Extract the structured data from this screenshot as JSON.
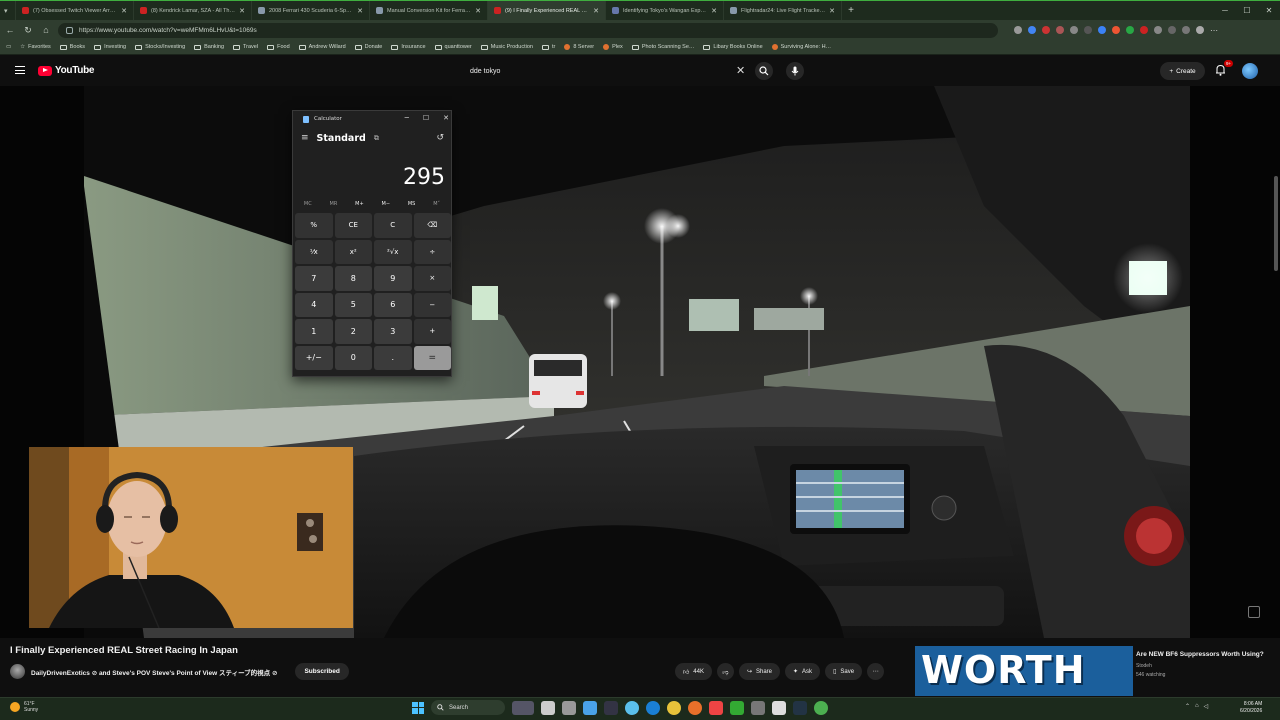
{
  "browser": {
    "tabs": [
      {
        "title": "(7) Obsessed Twitch Viewer Arre…",
        "color": "#cc2222"
      },
      {
        "title": "(8) Kendrick Lamar, SZA - All The…",
        "color": "#cc2222"
      },
      {
        "title": "2008 Ferrari 430 Scuderia 6-Spee…",
        "color": "#8899aa"
      },
      {
        "title": "Manual Conversion Kit for Ferrari…",
        "color": "#8899aa"
      },
      {
        "title": "(9) I Finally Experienced REAL Stre…",
        "color": "#cc2222"
      },
      {
        "title": "Identifying Tokyo's Wangan Expr…",
        "color": "#6677aa"
      },
      {
        "title": "Flightradar24: Live Flight Tracker …",
        "color": "#8899aa"
      }
    ],
    "url": "https://www.youtube.com/watch?v=weMFMm6LHvU&t=1069s",
    "bookmarks": [
      {
        "label": "Favorites",
        "type": "star"
      },
      {
        "label": "Books",
        "type": "folder"
      },
      {
        "label": "Investing",
        "type": "folder"
      },
      {
        "label": "Stocks/Investing",
        "type": "folder"
      },
      {
        "label": "Banking",
        "type": "folder"
      },
      {
        "label": "Travel",
        "type": "folder"
      },
      {
        "label": "Food",
        "type": "folder"
      },
      {
        "label": "Andrew Willard",
        "type": "folder"
      },
      {
        "label": "Donate",
        "type": "folder"
      },
      {
        "label": "Insurance",
        "type": "folder"
      },
      {
        "label": "quanttower",
        "type": "folder"
      },
      {
        "label": "Music Production",
        "type": "folder"
      },
      {
        "label": "tr",
        "type": "folder"
      },
      {
        "label": "8 Server",
        "type": "site"
      },
      {
        "label": "Plex",
        "type": "site"
      },
      {
        "label": "Photo Scanning Se…",
        "type": "folder"
      },
      {
        "label": "Libary Books Online",
        "type": "folder"
      },
      {
        "label": "Surviving Alone: H…",
        "type": "site"
      }
    ]
  },
  "youtube": {
    "logo": "YouTube",
    "search_value": "dde tokyo",
    "create_label": "Create",
    "notif_badge": "9+",
    "video_title": "I Finally Experienced REAL Street Racing In Japan",
    "channel": "DailyDrivenExotics ⊘ and Steve's POV Steve's Point of View スティーブ的視点 ⊘",
    "subscribe_label": "Subscribed",
    "actions": {
      "likes": "44K",
      "share": "Share",
      "ask": "Ask",
      "save": "Save"
    },
    "recommended": {
      "thumb_text": "WORTH IT?",
      "title": "Are NEW BF6 Suppressors Worth Using?",
      "channel": "Stodeh",
      "watching": "546 watching"
    }
  },
  "calculator": {
    "app_title": "Calculator",
    "mode": "Standard",
    "display": "295",
    "memory": [
      "MC",
      "MR",
      "M+",
      "M−",
      "MS",
      "M˅"
    ],
    "keys": [
      "%",
      "CE",
      "C",
      "⌫",
      "⅟x",
      "x²",
      "²√x",
      "÷",
      "7",
      "8",
      "9",
      "×",
      "4",
      "5",
      "6",
      "−",
      "1",
      "2",
      "3",
      "+",
      "+/−",
      "0",
      ".",
      "="
    ]
  },
  "taskbar": {
    "temp": "61°F",
    "condition": "Sunny",
    "search_label": "Search",
    "time": "8:06 AM",
    "date": "6/20/2026"
  }
}
